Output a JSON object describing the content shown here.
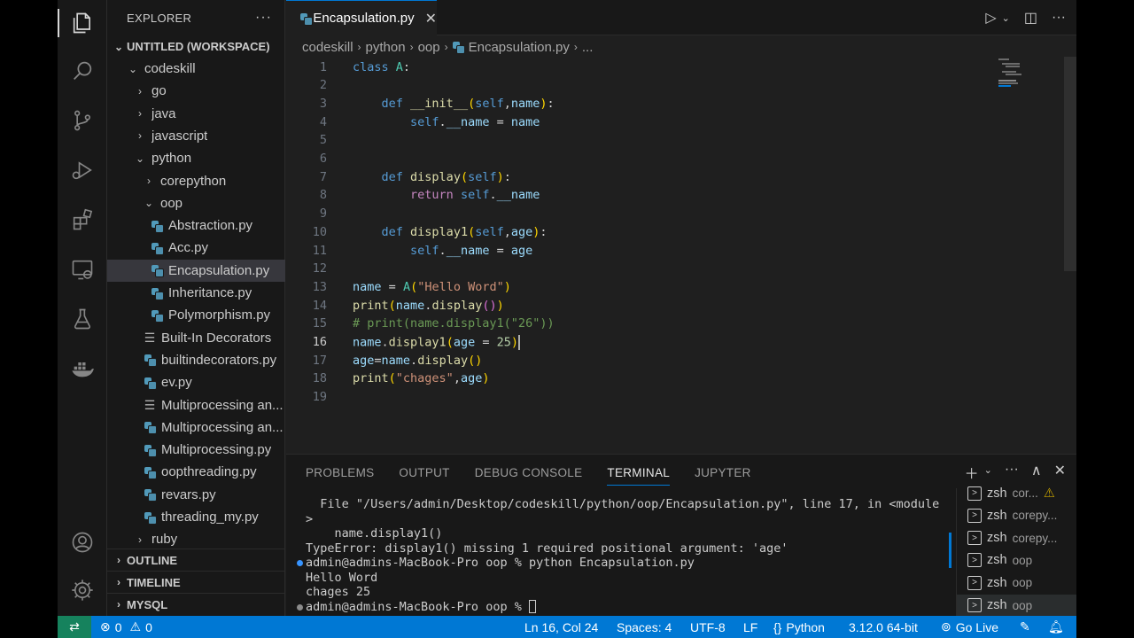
{
  "sidebar": {
    "title": "EXPLORER",
    "more": "···",
    "workspace": "UNTITLED (WORKSPACE)",
    "tree": [
      {
        "label": "codeskill",
        "type": "folder-open",
        "level": 1
      },
      {
        "label": "go",
        "type": "folder",
        "level": 2
      },
      {
        "label": "java",
        "type": "folder",
        "level": 2
      },
      {
        "label": "javascript",
        "type": "folder",
        "level": 2
      },
      {
        "label": "python",
        "type": "folder-open",
        "level": 2
      },
      {
        "label": "corepython",
        "type": "folder",
        "level": 3
      },
      {
        "label": "oop",
        "type": "folder-open",
        "level": 3
      },
      {
        "label": "Abstraction.py",
        "type": "py",
        "level": 4
      },
      {
        "label": "Acc.py",
        "type": "py",
        "level": 4
      },
      {
        "label": "Encapsulation.py",
        "type": "py",
        "level": 4,
        "selected": true
      },
      {
        "label": "Inheritance.py",
        "type": "py",
        "level": 4
      },
      {
        "label": "Polymorphism.py",
        "type": "py",
        "level": 4
      },
      {
        "label": "Built-In Decorators",
        "type": "text",
        "level": 3
      },
      {
        "label": "builtindecorators.py",
        "type": "py",
        "level": 3
      },
      {
        "label": "ev.py",
        "type": "py",
        "level": 3
      },
      {
        "label": "Multiprocessing an...",
        "type": "text",
        "level": 3
      },
      {
        "label": "Multiprocessing an...",
        "type": "py",
        "level": 3
      },
      {
        "label": "Multiprocessing.py",
        "type": "py",
        "level": 3
      },
      {
        "label": "oopthreading.py",
        "type": "py",
        "level": 3
      },
      {
        "label": "revars.py",
        "type": "py",
        "level": 3
      },
      {
        "label": "threading_my.py",
        "type": "py",
        "level": 3
      },
      {
        "label": "ruby",
        "type": "folder",
        "level": 2
      }
    ],
    "sections": [
      "OUTLINE",
      "TIMELINE",
      "MYSQL"
    ]
  },
  "editor": {
    "tab_label": "Encapsulation.py",
    "tab_close": "✕",
    "breadcrumb": [
      "codeskill",
      "python",
      "oop",
      "Encapsulation.py",
      "..."
    ],
    "current_line": 16,
    "lines": [
      {
        "n": "1",
        "code": "class A:"
      },
      {
        "n": "2",
        "code": ""
      },
      {
        "n": "3",
        "code": "    def __init__(self,name):"
      },
      {
        "n": "4",
        "code": "        self.__name = name"
      },
      {
        "n": "5",
        "code": ""
      },
      {
        "n": "6",
        "code": ""
      },
      {
        "n": "7",
        "code": "    def display(self):"
      },
      {
        "n": "8",
        "code": "        return self.__name"
      },
      {
        "n": "9",
        "code": ""
      },
      {
        "n": "10",
        "code": "    def display1(self,age):"
      },
      {
        "n": "11",
        "code": "        self.__name = age"
      },
      {
        "n": "12",
        "code": ""
      },
      {
        "n": "13",
        "code": "name = A(\"Hello Word\")"
      },
      {
        "n": "14",
        "code": "print(name.display())"
      },
      {
        "n": "15",
        "code": "# print(name.display1(\"26\"))"
      },
      {
        "n": "16",
        "code": "name.display1(age = 25)"
      },
      {
        "n": "17",
        "code": "age=name.display()"
      },
      {
        "n": "18",
        "code": "print(\"chages\",age)"
      },
      {
        "n": "19",
        "code": ""
      }
    ]
  },
  "panel": {
    "tabs": [
      "PROBLEMS",
      "OUTPUT",
      "DEBUG CONSOLE",
      "TERMINAL",
      "JUPYTER"
    ],
    "active_tab": "TERMINAL",
    "terminal_lines": [
      {
        "text": "  File \"/Users/admin/Desktop/codeskill/python/oop/Encapsulation.py\", line 17, in <module",
        "dot": null
      },
      {
        "text": ">",
        "dot": null
      },
      {
        "text": "    name.display1()",
        "dot": null
      },
      {
        "text": "TypeError: display1() missing 1 required positional argument: 'age'",
        "dot": null
      },
      {
        "text": "admin@admins-MacBook-Pro oop % python Encapsulation.py",
        "dot": "blue"
      },
      {
        "text": "Hello Word",
        "dot": null
      },
      {
        "text": "chages 25",
        "dot": null
      },
      {
        "text": "admin@admins-MacBook-Pro oop % ",
        "dot": "grey",
        "cursor": true
      }
    ],
    "terminals": [
      {
        "name": "zsh",
        "sub": "cor...",
        "warn": "⚠"
      },
      {
        "name": "zsh",
        "sub": "corepy..."
      },
      {
        "name": "zsh",
        "sub": "corepy..."
      },
      {
        "name": "zsh",
        "sub": "oop"
      },
      {
        "name": "zsh",
        "sub": "oop"
      },
      {
        "name": "zsh",
        "sub": "oop",
        "active": true
      }
    ]
  },
  "statusbar": {
    "errors": "0",
    "warnings": "0",
    "position": "Ln 16, Col 24",
    "spaces": "Spaces: 4",
    "encoding": "UTF-8",
    "eol": "LF",
    "language": "Python",
    "interpreter": "3.12.0 64-bit",
    "golive": "Go Live"
  },
  "colors": {
    "accent": "#0078d4",
    "statusbar": "#0078d4",
    "remote": "#16825d",
    "selected_row": "#37373d"
  }
}
